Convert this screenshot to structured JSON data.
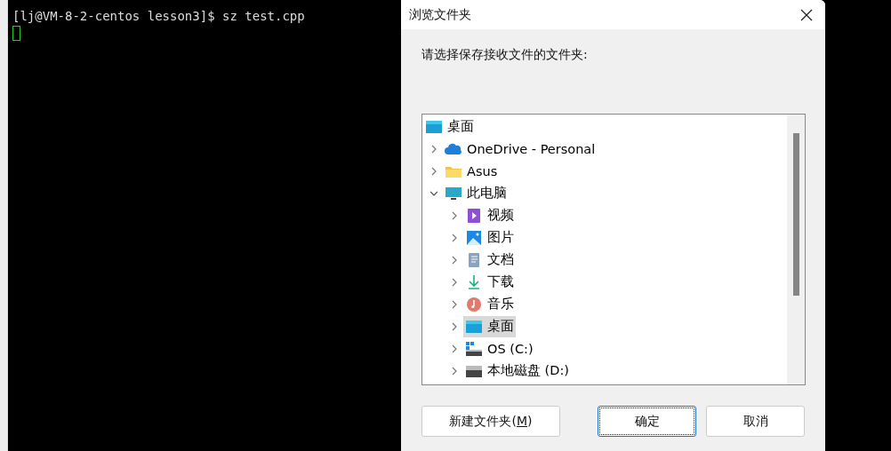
{
  "terminal": {
    "lines": [
      "[lj@VM-8-2-centos lesson3]$ sz test.cpp"
    ]
  },
  "dialog": {
    "title": "浏览文件夹",
    "prompt": "请选择保存接收文件的文件夹:",
    "tree": [
      {
        "label": "桌面",
        "kind": "desktop",
        "selected": false,
        "children": [
          {
            "label": "OneDrive - Personal",
            "kind": "cloud",
            "expanded": false,
            "selected": false
          },
          {
            "label": "Asus",
            "kind": "folder",
            "expanded": false,
            "selected": false
          },
          {
            "label": "此电脑",
            "kind": "monitor",
            "expanded": true,
            "selected": false,
            "children": [
              {
                "label": "视频",
                "kind": "video",
                "expanded": false,
                "selected": false
              },
              {
                "label": "图片",
                "kind": "pictures",
                "expanded": false,
                "selected": false
              },
              {
                "label": "文档",
                "kind": "document",
                "expanded": false,
                "selected": false
              },
              {
                "label": "下载",
                "kind": "download",
                "expanded": false,
                "selected": false
              },
              {
                "label": "音乐",
                "kind": "music",
                "expanded": false,
                "selected": false
              },
              {
                "label": "桌面",
                "kind": "desktop",
                "expanded": false,
                "selected": true
              },
              {
                "label": "OS (C:)",
                "kind": "os-drive",
                "expanded": false,
                "selected": false
              },
              {
                "label": "本地磁盘 (D:)",
                "kind": "drive",
                "expanded": false,
                "selected": false
              }
            ]
          }
        ]
      }
    ],
    "buttons": [
      {
        "label": "新建文件夹(",
        "mnemonic": "M",
        "suffix": ")",
        "focused": false
      },
      {
        "label": "确定",
        "focused": true
      },
      {
        "label": "取消",
        "focused": false
      }
    ]
  }
}
